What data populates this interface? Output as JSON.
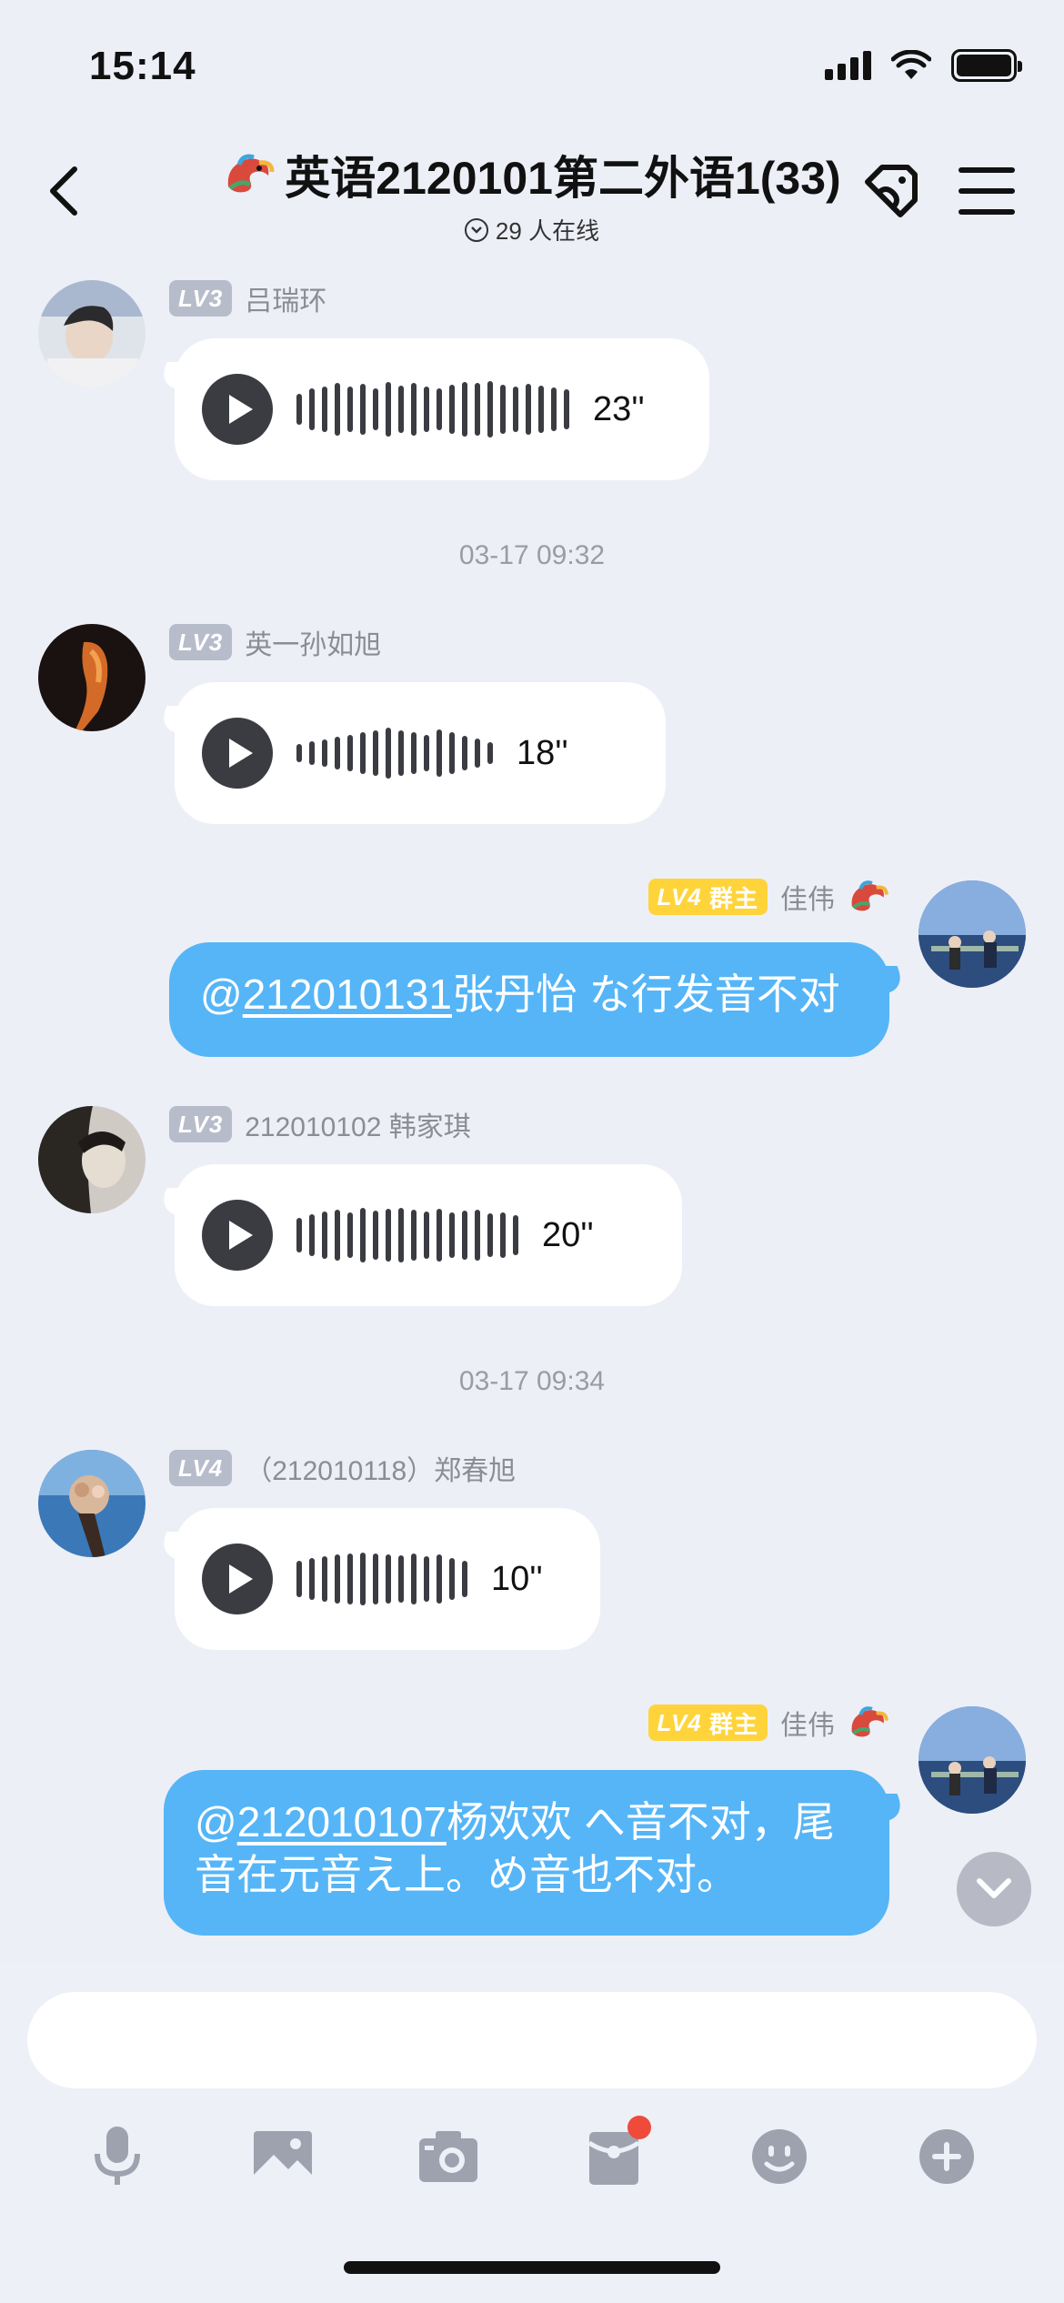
{
  "status_bar": {
    "time": "15:14"
  },
  "nav": {
    "title": "英语2120101第二外语1(33)",
    "online_text": "29 人在线"
  },
  "messages": [
    {
      "sender_level": "LV3",
      "sender_name": "吕瑞环",
      "type": "voice",
      "duration": "23''"
    },
    {
      "timestamp": "03-17 09:32"
    },
    {
      "sender_level": "LV3",
      "sender_name": "英一孙如旭",
      "type": "voice",
      "duration": "18''"
    },
    {
      "sender_level": "LV4",
      "sender_role": "群主",
      "sender_name": "佳伟",
      "type": "text",
      "mention": "@",
      "mention_id": "212010131",
      "text_rest": "张丹怡 な行发音不对"
    },
    {
      "sender_level": "LV3",
      "sender_name": "212010102 韩家琪",
      "type": "voice",
      "duration": "20''"
    },
    {
      "timestamp": "03-17 09:34"
    },
    {
      "sender_level": "LV4",
      "sender_name": "（212010118）郑春旭",
      "type": "voice",
      "duration": "10''"
    },
    {
      "sender_level": "LV4",
      "sender_role": "群主",
      "sender_name": "佳伟",
      "type": "text",
      "mention": "@",
      "mention_id": "212010107",
      "text_rest": "杨欢欢 へ音不对，尾",
      "text_line2": "音在元音え上。め音也不对。"
    }
  ],
  "input": {
    "placeholder": ""
  },
  "toolbar": {
    "icons": [
      "microphone-icon",
      "image-icon",
      "camera-icon",
      "red-packet-icon",
      "emoji-icon",
      "plus-icon"
    ],
    "notification_dot_color": "#f04a3a"
  },
  "colors": {
    "outgoing_bubble": "#55b5f7",
    "owner_badge": "#ffd43a",
    "level_badge": "#b7bccb"
  }
}
